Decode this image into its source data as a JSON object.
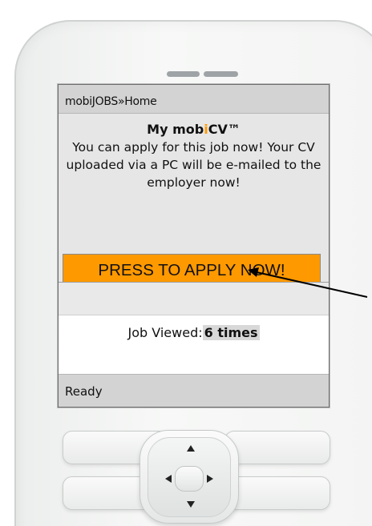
{
  "screen": {
    "breadcrumb": "mobiJOBS»Home",
    "cv_title_prefix": "My mob",
    "cv_title_highlight": "i",
    "cv_title_suffix": "CV™",
    "message": "You can apply for this job now! Your CV uploaded via a PC will be e-mailed to the employer now!",
    "apply_button": "PRESS TO APPLY NOW!",
    "job_viewed_label": "Job Viewed:",
    "job_viewed_count": "6 times",
    "status": "Ready"
  },
  "icons": {
    "up": "arrow-up-icon",
    "down": "arrow-down-icon",
    "left": "arrow-left-icon",
    "right": "arrow-right-icon"
  },
  "colors": {
    "accent_orange": "#ff9900",
    "phone_body": "#eceeed",
    "screen_bar": "#d3d3d3",
    "annotation_arrow": "#000000"
  }
}
